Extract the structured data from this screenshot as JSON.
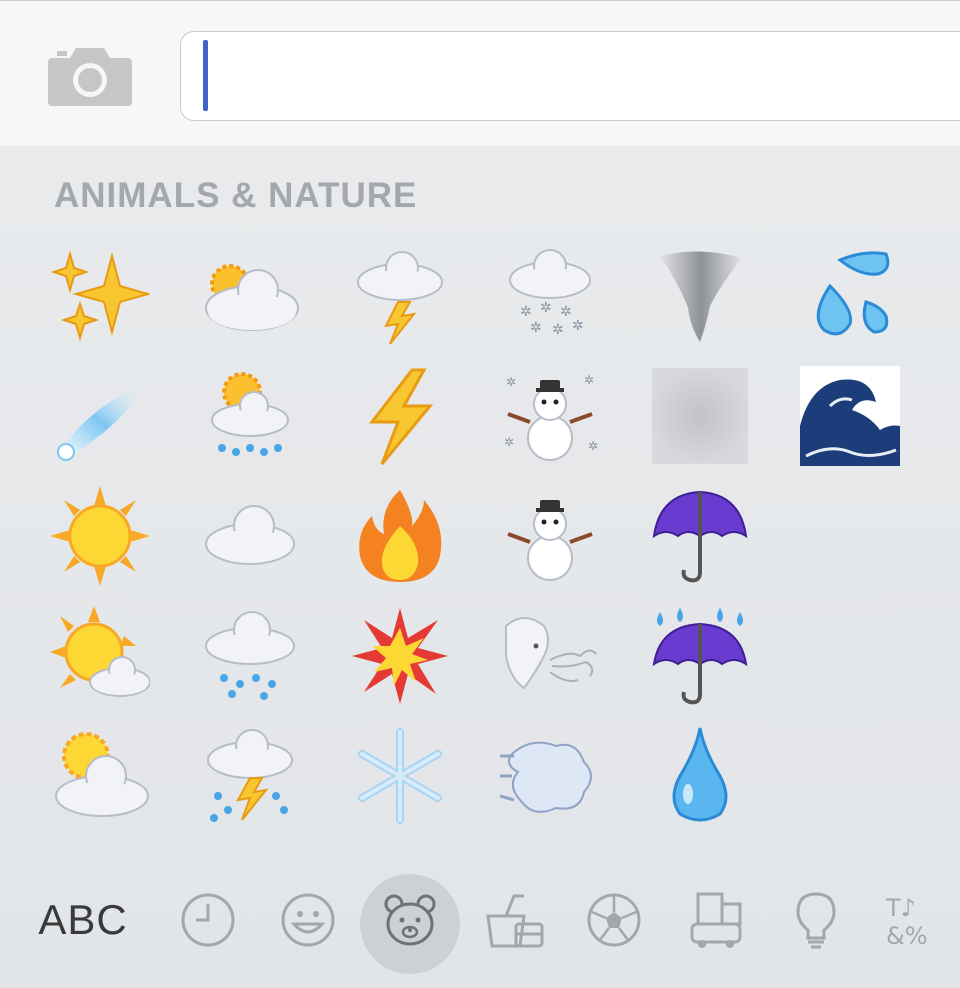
{
  "camera_icon": "camera-icon",
  "input": {
    "value": "",
    "placeholder": ""
  },
  "section_title": "ANIMALS & NATURE",
  "emoji_grid": [
    [
      "sparkles",
      "sun-behind-small-cloud",
      "cloud-with-lightning",
      "cloud-with-snow",
      "tornado",
      "sweat-droplets"
    ],
    [
      "comet",
      "sun-behind-rain-cloud",
      "high-voltage",
      "snowman",
      "fog",
      "water-wave"
    ],
    [
      "sun",
      "cloud",
      "fire",
      "snowman-without-snow",
      "umbrella",
      ""
    ],
    [
      "sun-behind-cloud",
      "cloud-with-rain",
      "collision",
      "wind-face",
      "umbrella-with-rain-drops",
      ""
    ],
    [
      "sun-behind-large-cloud",
      "cloud-with-lightning-and-rain",
      "snowflake",
      "dashing-away",
      "droplet",
      ""
    ]
  ],
  "bottom_bar": {
    "abc_label": "ABC",
    "categories": [
      "clock-icon",
      "smiley-icon",
      "bear-icon",
      "food-icon",
      "soccer-ball-icon",
      "city-icon",
      "lightbulb-icon",
      "symbols-icon"
    ],
    "selected": "bear-icon"
  },
  "colors": {
    "caret": "#3f63c9",
    "section_title": "#a4a8ad",
    "selected_bg": "#cdd0d4"
  }
}
